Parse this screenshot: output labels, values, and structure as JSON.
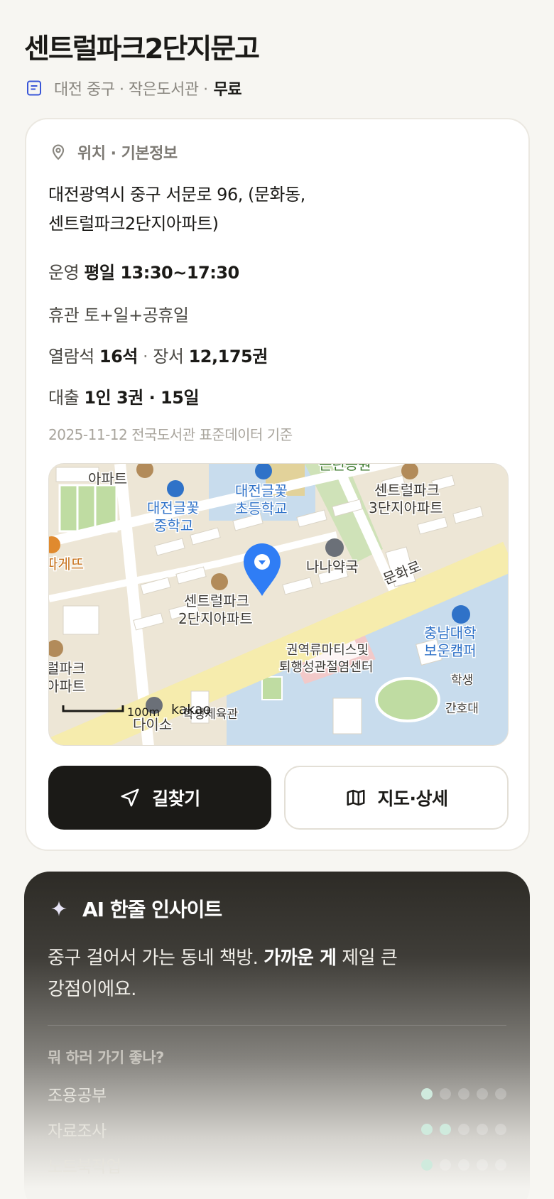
{
  "header": {
    "title": "센트럴파크2단지문고",
    "subline": "대전 중구 · 작은도서관 ·",
    "fee": "무료"
  },
  "info": {
    "section_title": "위치 · 기본정보",
    "address_line1": "대전광역시 중구 서문로 96, (문화동,",
    "address_line2": "센트럴파크2단지아파트)",
    "hours_label": "운영",
    "hours_value": "평일 13:30~17:30",
    "closed_label": "휴관",
    "closed_value": "토+일+공휴일",
    "seats_label": "열람석",
    "seats_value": "16석",
    "books_label": "장서",
    "books_value": "12,175권",
    "loan_label": "대출",
    "loan_value": "1인 3권 · 15일",
    "source": "2025-11-12 전국도서관 표준데이터 기준"
  },
  "map": {
    "labels": {
      "apt_top": "아파트",
      "school_middle_1": "대전글꽃",
      "school_middle_2": "중학교",
      "school_elem_1": "대전글꽃",
      "school_elem_2": "초등학교",
      "park": "근린공원",
      "cp3_1": "센트럴파크",
      "cp3_2": "3단지아파트",
      "ttarge": "따게뜨",
      "pharmacy": "나나약국",
      "road": "문화로",
      "cp2_1": "센트럴파크",
      "cp2_2": "2단지아파트",
      "univ_1": "충남대학",
      "univ_2": "보운캠퍼",
      "center_1": "권역류마티스및",
      "center_2": "퇴행성관절염센터",
      "cp_left_1": "럴파크",
      "cp_left_2": "아파트",
      "student": "학생",
      "nursing": "간호대",
      "gym": "학생체육관",
      "daiso": "다이소",
      "scale": "100m",
      "brand": "kakao"
    },
    "colors": {
      "land": "#ede6d6",
      "road": "#f8efb2",
      "water": "#c8dced",
      "green": "#cfe2b8",
      "marker": "#2f7df5"
    }
  },
  "buttons": {
    "directions": "길찾기",
    "map_detail": "지도·상세"
  },
  "ai": {
    "title": "AI 한줄 인사이트",
    "text_before": "중구 걸어서 가는 동네 책방.",
    "text_bold": "가까운 게",
    "text_after": "제일 큰",
    "text_line2": "강점이에요.",
    "question": "뭐 하러 가기 좋나?",
    "purposes": [
      {
        "label": "조용공부",
        "score": 1
      },
      {
        "label": "자료조사",
        "score": 2
      },
      {
        "label": "노트북작업",
        "score": 1
      }
    ],
    "max_score": 5
  }
}
